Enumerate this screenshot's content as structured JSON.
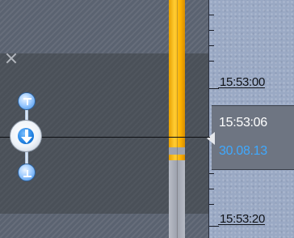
{
  "timeline": {
    "ticks": [
      "15:53:00",
      "15:53:20"
    ],
    "cursor": {
      "time": "15:53:06",
      "date": "30.08.13"
    }
  },
  "controls": {
    "close_icon": "close-icon",
    "step_up_icon": "step-up-icon",
    "go_to_cursor_icon": "arrow-down-icon",
    "step_down_icon": "step-down-icon"
  },
  "colors": {
    "recording_bar": "#ffb300",
    "date_text": "#3fa9ff",
    "accent_button": "#1d7fe0"
  }
}
